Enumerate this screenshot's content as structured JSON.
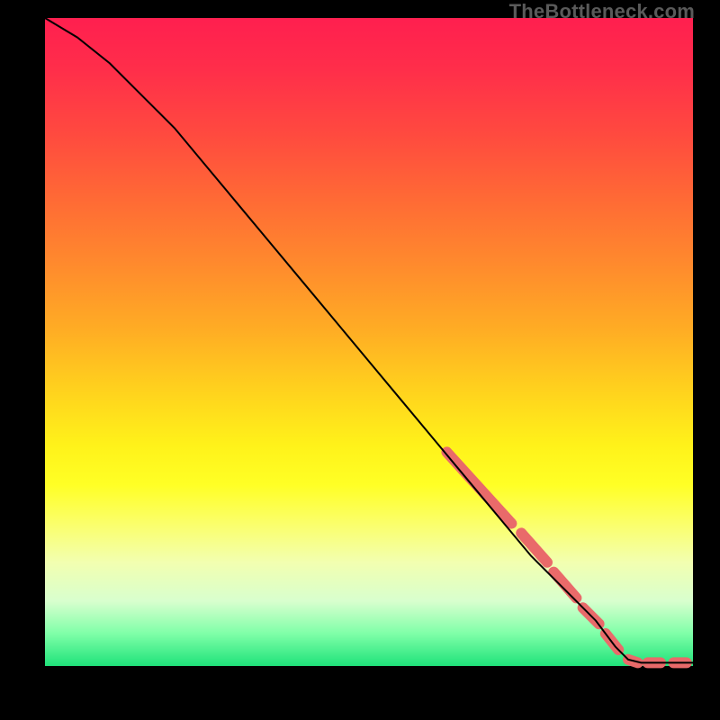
{
  "brand": "TheBottleneck.com",
  "chart_data": {
    "type": "line",
    "title": "",
    "xlabel": "",
    "ylabel": "",
    "xlim": [
      0,
      100
    ],
    "ylim": [
      0,
      100
    ],
    "grid": false,
    "legend": false,
    "series": [
      {
        "name": "curve",
        "x": [
          0,
          5,
          10,
          15,
          20,
          25,
          30,
          35,
          40,
          45,
          50,
          55,
          60,
          65,
          70,
          75,
          80,
          85,
          88,
          90,
          92,
          94,
          96,
          98,
          100
        ],
        "y": [
          100,
          97,
          93,
          88,
          83,
          77,
          71,
          65,
          59,
          53,
          47,
          41,
          35,
          29,
          23,
          17,
          12,
          7,
          3,
          1,
          0.5,
          0.5,
          0.5,
          0.5,
          0.5
        ],
        "color": "#000000"
      },
      {
        "name": "highlight-dashes",
        "segments": [
          {
            "x": [
              62,
              72
            ],
            "y": [
              33,
              22
            ]
          },
          {
            "x": [
              73.5,
              77.5
            ],
            "y": [
              20.5,
              16
            ]
          },
          {
            "x": [
              78.5,
              82
            ],
            "y": [
              14.5,
              10.5
            ]
          },
          {
            "x": [
              83,
              85.5
            ],
            "y": [
              9,
              6.5
            ]
          },
          {
            "x": [
              86.5,
              88.5
            ],
            "y": [
              5,
              2.5
            ]
          },
          {
            "x": [
              90,
              91.5
            ],
            "y": [
              1,
              0.5
            ]
          },
          {
            "x": [
              93,
              95
            ],
            "y": [
              0.5,
              0.5
            ]
          },
          {
            "x": [
              97,
              99
            ],
            "y": [
              0.5,
              0.5
            ]
          }
        ],
        "color": "#e96a6a",
        "stroke_width_px": 12
      }
    ]
  },
  "palette": {
    "gradient_top": "#ff1f4f",
    "gradient_mid": "#ffe81a",
    "gradient_bot": "#1fe27a",
    "dash_color": "#e96a6a",
    "curve_color": "#000000",
    "frame_color": "#000000"
  }
}
